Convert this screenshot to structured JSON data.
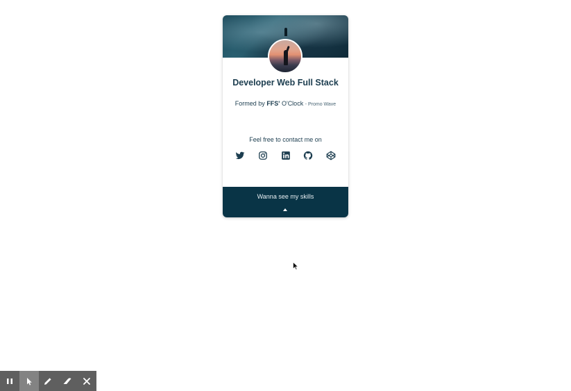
{
  "profile": {
    "title": "Developer Web Full Stack",
    "formed_prefix": "Formed by",
    "formed_brand": "FFS'",
    "formed_school": "O'Clock",
    "formed_promo": "- Promo Wave",
    "contact_text": "Feel free to contact me on"
  },
  "socials": [
    {
      "name": "twitter-icon"
    },
    {
      "name": "instagram-icon"
    },
    {
      "name": "linkedin-icon"
    },
    {
      "name": "github-icon"
    },
    {
      "name": "codepen-icon"
    }
  ],
  "skills_button": {
    "label": "Wanna see my skills",
    "icon": "caret-up-icon"
  },
  "toolbar": {
    "tools": [
      "pause-icon",
      "pointer-icon",
      "pen-icon",
      "eraser-icon",
      "close-icon"
    ],
    "active": "pointer-icon"
  },
  "colors": {
    "primary": "#1c3d4f",
    "footer": "#093446",
    "toolbar": "#5f5f5f",
    "toolbar_active": "#838383"
  }
}
